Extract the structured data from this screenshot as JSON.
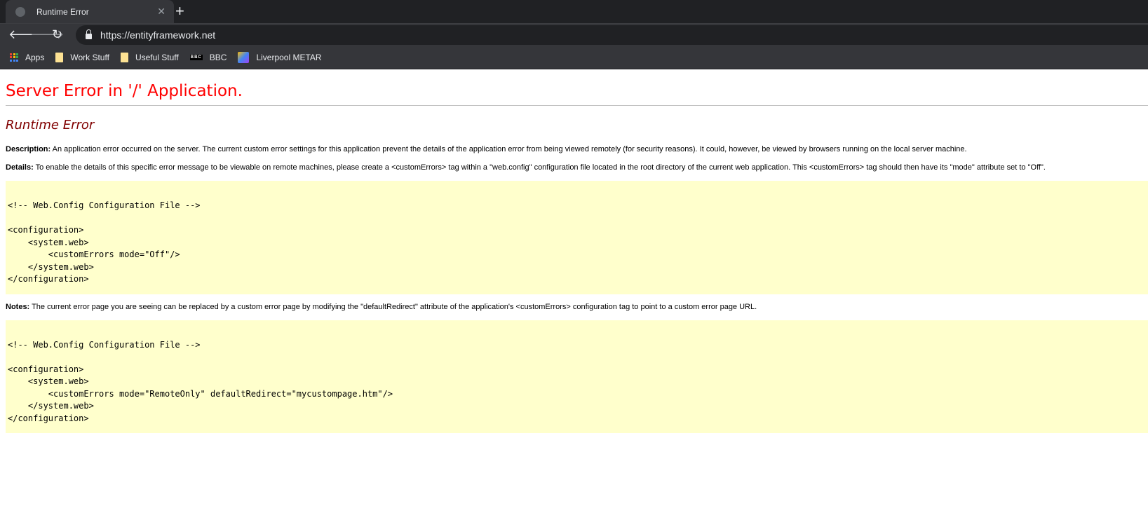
{
  "browser": {
    "tab_title": "Runtime Error",
    "url": "https://entityframework.net",
    "bookmarks": [
      {
        "label": "Apps",
        "icon": "apps-grid-icon"
      },
      {
        "label": "Work Stuff",
        "icon": "folder-icon"
      },
      {
        "label": "Useful Stuff",
        "icon": "folder-icon"
      },
      {
        "label": "BBC",
        "icon": "bbc-icon",
        "icon_text": "BBC"
      },
      {
        "label": "Liverpool METAR",
        "icon": "metar-icon"
      }
    ]
  },
  "page": {
    "title": "Server Error in '/' Application.",
    "subtitle": "Runtime Error",
    "description_label": "Description:",
    "description": " An application error occurred on the server. The current custom error settings for this application prevent the details of the application error from being viewed remotely (for security reasons). It could, however, be viewed by browsers running on the local server machine.",
    "details_label": "Details:",
    "details": " To enable the details of this specific error message to be viewable on remote machines, please create a <customErrors> tag within a \"web.config\" configuration file located in the root directory of the current web application. This <customErrors> tag should then have its \"mode\" attribute set to \"Off\".",
    "code1": "<!-- Web.Config Configuration File -->\n\n<configuration>\n    <system.web>\n        <customErrors mode=\"Off\"/>\n    </system.web>\n</configuration>",
    "notes_label": "Notes:",
    "notes": " The current error page you are seeing can be replaced by a custom error page by modifying the \"defaultRedirect\" attribute of the application's <customErrors> configuration tag to point to a custom error page URL.",
    "code2": "<!-- Web.Config Configuration File -->\n\n<configuration>\n    <system.web>\n        <customErrors mode=\"RemoteOnly\" defaultRedirect=\"mycustompage.htm\"/>\n    </system.web>\n</configuration>"
  },
  "colors": {
    "title": "#ff0000",
    "subtitle": "#800000",
    "code_bg": "#ffffcc"
  }
}
